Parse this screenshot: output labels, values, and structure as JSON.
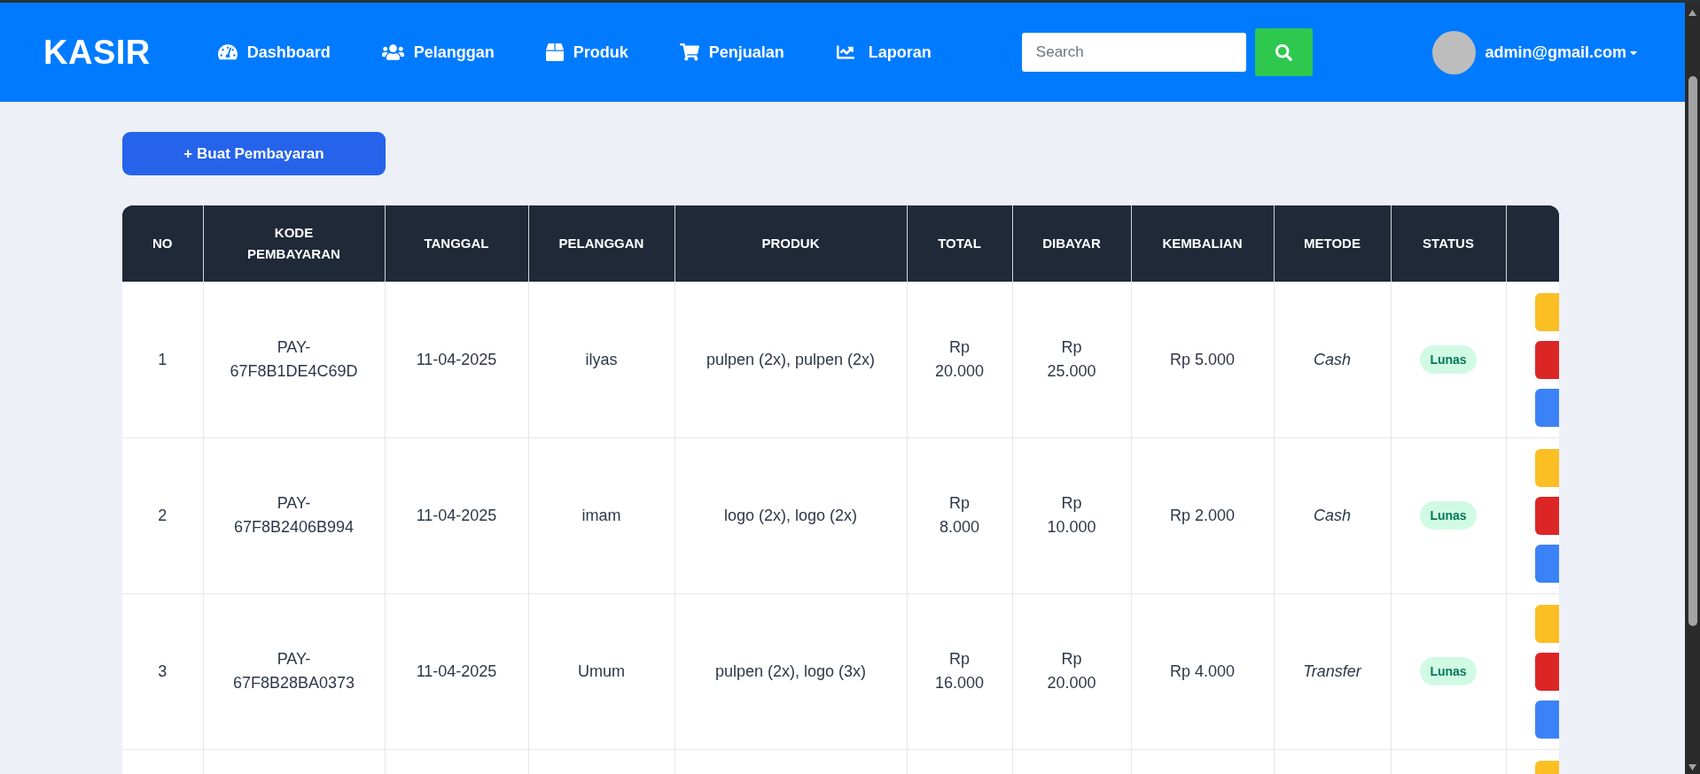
{
  "navbar": {
    "brand": "KASIR",
    "nav_items": [
      {
        "label": "Dashboard",
        "selected": false
      },
      {
        "label": "Pelanggan",
        "selected": false
      },
      {
        "label": "Produk",
        "selected": false
      },
      {
        "label": "Penjualan",
        "selected": false
      },
      {
        "label": "Laporan",
        "selected": false
      }
    ],
    "search": {
      "placeholder": "Search"
    },
    "user": {
      "email": "admin@gmail.com"
    }
  },
  "toolbar": {
    "create_button": "+ Buat Pembayaran"
  },
  "table": {
    "columns": [
      "NO",
      "KODE PEMBAYARAN",
      "TANGGAL",
      "PELANGGAN",
      "PRODUK",
      "TOTAL",
      "DIBAYAR",
      "KEMBALIAN",
      "METODE",
      "STATUS"
    ],
    "rows": [
      {
        "no": "1",
        "kode": "PAY-67F8B1DE4C69D",
        "tanggal": "11-04-2025",
        "pelanggan": "ilyas",
        "produk": "pulpen (2x), pulpen (2x)",
        "total": "Rp 20.000",
        "dibayar": "Rp 25.000",
        "kembalian": "Rp 5.000",
        "metode": "Cash",
        "status": "Lunas",
        "actions": [
          {
            "kind": "warning"
          },
          {
            "kind": "danger"
          },
          {
            "kind": "primary"
          }
        ]
      },
      {
        "no": "2",
        "kode": "PAY-67F8B2406B994",
        "tanggal": "11-04-2025",
        "pelanggan": "imam",
        "produk": "logo (2x), logo (2x)",
        "total": "Rp 8.000",
        "dibayar": "Rp 10.000",
        "kembalian": "Rp 2.000",
        "metode": "Cash",
        "status": "Lunas",
        "actions": [
          {
            "kind": "warning"
          },
          {
            "kind": "danger"
          },
          {
            "kind": "primary"
          }
        ]
      },
      {
        "no": "3",
        "kode": "PAY-67F8B28BA0373",
        "tanggal": "11-04-2025",
        "pelanggan": "Umum",
        "produk": "pulpen (2x), logo (3x)",
        "total": "Rp 16.000",
        "dibayar": "Rp 20.000",
        "kembalian": "Rp 4.000",
        "metode": "Transfer",
        "status": "Lunas",
        "actions": [
          {
            "kind": "warning"
          },
          {
            "kind": "danger"
          },
          {
            "kind": "primary"
          }
        ]
      },
      {
        "actions": [
          {
            "kind": "warning"
          }
        ]
      }
    ]
  }
}
